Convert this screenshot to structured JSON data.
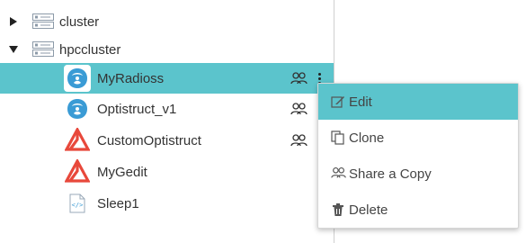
{
  "tree": {
    "groups": [
      {
        "label": "cluster",
        "expanded": false
      },
      {
        "label": "hpccluster",
        "expanded": true
      }
    ],
    "apps": [
      {
        "label": "MyRadioss",
        "icon": "radioss-icon",
        "shared": true,
        "selected": true
      },
      {
        "label": "Optistruct_v1",
        "icon": "radioss-icon",
        "shared": true,
        "selected": false
      },
      {
        "label": "CustomOptistruct",
        "icon": "altair-logo-icon",
        "shared": true,
        "selected": false
      },
      {
        "label": "MyGedit",
        "icon": "altair-logo-icon",
        "shared": false,
        "selected": false
      },
      {
        "label": "Sleep1",
        "icon": "script-file-icon",
        "shared": false,
        "selected": false
      }
    ]
  },
  "context_menu": {
    "items": [
      {
        "label": "Edit",
        "icon": "edit-icon",
        "active": true
      },
      {
        "label": "Clone",
        "icon": "clone-icon",
        "active": false
      },
      {
        "label": "Share a Copy",
        "icon": "share-icon",
        "active": false
      },
      {
        "label": "Delete",
        "icon": "trash-icon",
        "active": false
      }
    ]
  },
  "colors": {
    "selection": "#5bc4cc",
    "altair_red": "#e8483b",
    "radioss_blue": "#3a9bd5"
  }
}
